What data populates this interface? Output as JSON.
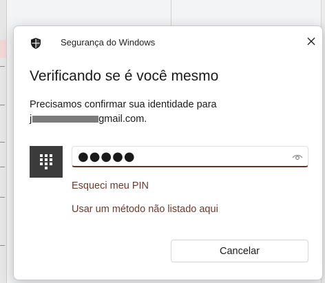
{
  "dialog": {
    "app_title": "Segurança do Windows",
    "heading": "Verificando se é você mesmo",
    "description_line1": "Precisamos confirmar sua identidade para",
    "email_prefix": "j",
    "email_suffix": "gmail.com.",
    "pin": {
      "value": "●●●●●",
      "tile_icon": "keypad-icon",
      "reveal_icon": "eye-icon"
    },
    "forgot_pin_label": "Esqueci meu PIN",
    "other_method_label": "Usar um método não listado aqui",
    "cancel_label": "Cancelar",
    "close_icon": "close-icon",
    "shield_icon": "shield-icon"
  },
  "colors": {
    "link": "#6b3a2c",
    "input_accent": "#5b3325",
    "tile_bg": "#3b3b3b"
  }
}
